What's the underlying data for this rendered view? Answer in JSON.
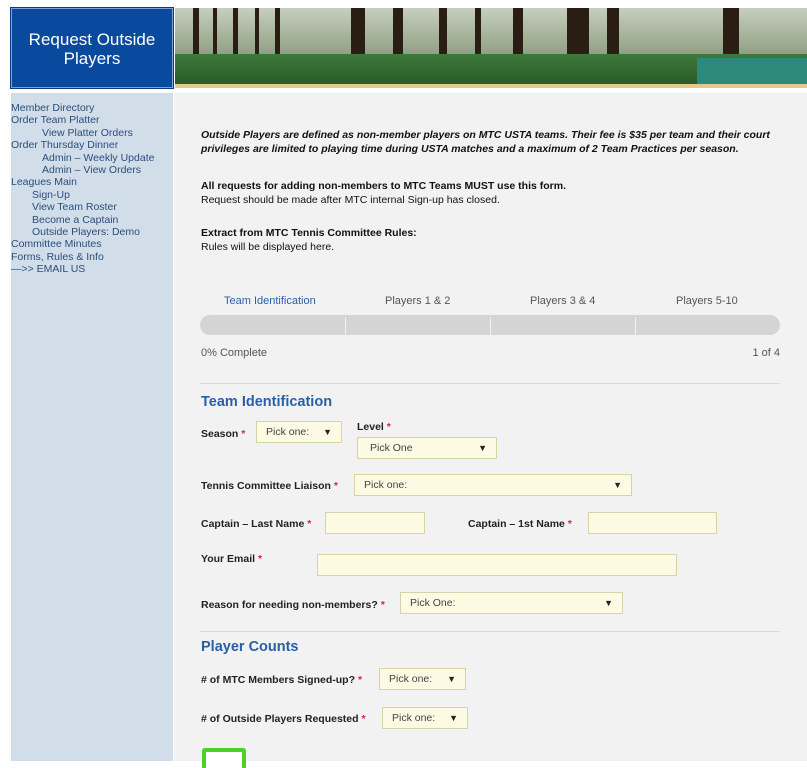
{
  "header": {
    "title": "Request Outside Players"
  },
  "sidebar": {
    "items": [
      {
        "label": "Member Directory",
        "level": 0
      },
      {
        "label": "Order Team Platter",
        "level": 0
      },
      {
        "label": "View Platter Orders",
        "level": 2
      },
      {
        "label": "Order Thursday Dinner",
        "level": 0
      },
      {
        "label": "Admin – Weekly Update",
        "level": 2
      },
      {
        "label": "Admin – View Orders",
        "level": 2
      },
      {
        "label": "Leagues Main",
        "level": 0
      },
      {
        "label": "Sign-Up",
        "level": 1
      },
      {
        "label": "View Team Roster",
        "level": 1
      },
      {
        "label": "Become a Captain",
        "level": 1
      },
      {
        "label": "Outside Players: Demo",
        "level": 1
      },
      {
        "label": "Committee Minutes",
        "level": 0
      },
      {
        "label": "Forms, Rules & Info",
        "level": 0
      },
      {
        "label": "—>> EMAIL US",
        "level": 0
      }
    ]
  },
  "intro": {
    "definition": "Outside Players are defined as non-member players on MTC USTA teams. Their fee is $35 per team and their court privileges are limited to playing time during USTA matches and a maximum of 2 Team Practices per season.",
    "must_use": "All requests for adding non-members to MTC Teams MUST use this form.",
    "timing": "Request should be made after MTC internal Sign-up has closed.",
    "extract_title": "Extract from MTC Tennis Committee Rules:",
    "extract_body": "Rules will be displayed here."
  },
  "steps": {
    "tabs": [
      "Team Identification",
      "Players 1 & 2",
      "Players 3 & 4",
      "Players 5-10"
    ],
    "progress": 0,
    "progress_label": "0% Complete",
    "page_indicator": "1 of 4"
  },
  "form": {
    "section1_title": "Team Identification",
    "season_label": "Season",
    "season_value": "Pick one:",
    "level_label": "Level",
    "level_value": "Pick One",
    "liaison_label": "Tennis Committee Liaison",
    "liaison_value": "Pick one:",
    "captain_last_label": "Captain – Last Name",
    "captain_first_label": "Captain – 1st Name",
    "email_label": "Your Email",
    "reason_label": "Reason for needing non-members?",
    "reason_value": "Pick One:",
    "section2_title": "Player Counts",
    "members_label": "# of MTC Members Signed-up?",
    "members_value": "Pick one:",
    "outside_label": "# of Outside Players Requested",
    "outside_value": "Pick one:",
    "required_mark": "*",
    "arrow": "▼"
  },
  "colors": {
    "accent": "#2a5fa8",
    "header_bg": "#0a4a9e",
    "sidebar_bg": "#d2ddea",
    "required": "#d9233f",
    "field_bg": "#fdfae4",
    "submit_border": "#4cd12b"
  }
}
